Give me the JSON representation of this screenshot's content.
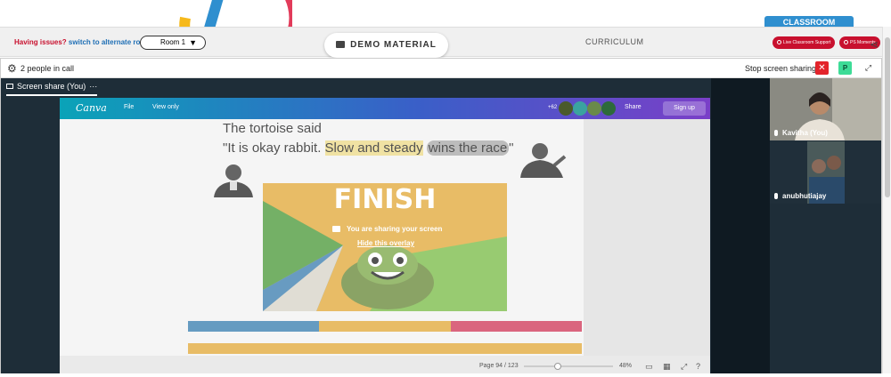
{
  "header": {
    "classroom_tab": "CLASSROOM",
    "issues_text": "Having issues?",
    "alternate_link": "switch to alternate room",
    "room_select": "Room 1",
    "demo_material": "DEMO MATERIAL",
    "curriculum": "CURRICULUM",
    "live_support": "Live Classroom Support",
    "ps_moments": "PS Moments"
  },
  "call": {
    "people_count": "2 people in call",
    "stop_sharing": "Stop screen sharing",
    "p_badge": "P",
    "close_glyph": "✕",
    "screen_share_tab": "Screen share (You)",
    "tab_more": "···",
    "overlay_message": "You are sharing your screen",
    "overlay_hide": "Hide this overlay"
  },
  "canva": {
    "logo": "Canva",
    "file": "File",
    "view_only": "View only",
    "collab_count": "+62",
    "share": "Share",
    "signup": "Sign up",
    "page_indicator": "Page 94 / 123",
    "zoom": "48%"
  },
  "slide": {
    "line1": "The tortoise said",
    "line2_start": "\"It is okay rabbit. ",
    "line2_yellow": "Slow and steady",
    "line2_grey": "wins the race",
    "line2_end": "\"",
    "finish_word": "FINISH"
  },
  "participants": [
    {
      "name": "Kavitha (You)"
    },
    {
      "name": "anubhutiajay"
    }
  ],
  "colors": {
    "brand_red": "#c8102e",
    "classroom_blue": "#2f8fcf",
    "stage_bg": "#1e2d38",
    "stop_red": "#e3242b",
    "p_green": "#3ddc97"
  }
}
